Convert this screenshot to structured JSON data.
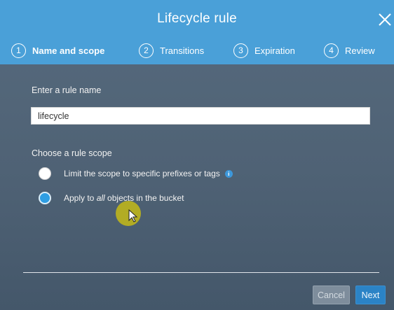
{
  "dialog": {
    "title": "Lifecycle rule",
    "close_icon": "close-icon"
  },
  "steps": [
    {
      "number": "1",
      "label": "Name and scope",
      "active": true
    },
    {
      "number": "2",
      "label": "Transitions",
      "active": false
    },
    {
      "number": "3",
      "label": "Expiration",
      "active": false
    },
    {
      "number": "4",
      "label": "Review",
      "active": false
    }
  ],
  "rule_name": {
    "label": "Enter a rule name",
    "value": "lifecycle"
  },
  "scope": {
    "label": "Choose a rule scope",
    "options": [
      {
        "text": "Limit the scope to specific prefixes or tags",
        "selected": false,
        "icon": "info-icon"
      },
      {
        "text_before": "Apply to ",
        "text_em": "all",
        "text_after": " objects in the bucket",
        "selected": true
      }
    ]
  },
  "footer": {
    "cancel_label": "Cancel",
    "next_label": "Next"
  },
  "colors": {
    "header": "#4aa0d8",
    "body": "#4f6275",
    "radio_selected": "#2f9ee3",
    "next_button": "#2b83c6",
    "cursor_highlight": "#c4ba16"
  }
}
